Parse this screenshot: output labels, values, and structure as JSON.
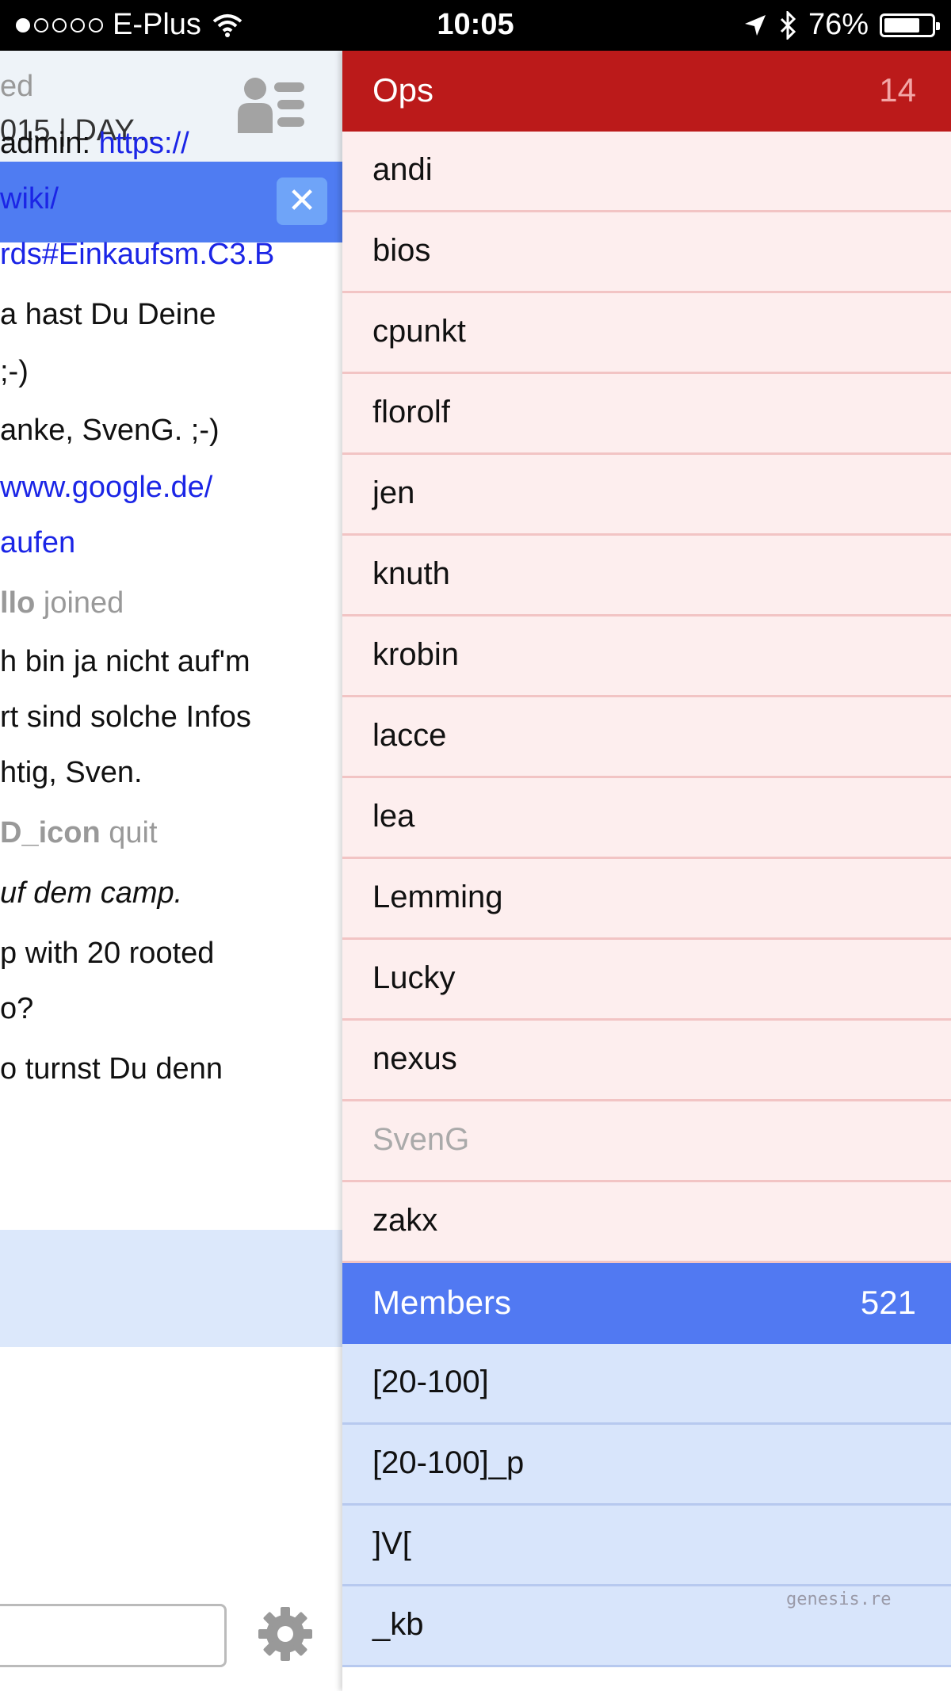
{
  "status_bar": {
    "signal_dots": [
      true,
      false,
      false,
      false,
      false
    ],
    "carrier": "E-Plus",
    "time": "10:05",
    "battery_percent": "76%",
    "battery_level": 0.76
  },
  "chat": {
    "title": "015 | DAY...",
    "close_label": "✕",
    "lines": [
      {
        "text": "ed",
        "style": "gray"
      },
      {
        "text": "admin: ",
        "link": "https://"
      },
      {
        "link": "wiki/"
      },
      {
        "link": "rds#Einkaufsm.C3.B"
      },
      {
        "text": "a hast Du Deine"
      },
      {
        "text": "    ;-)"
      },
      {
        "text": "anke, SvenG.   ;-)"
      },
      {
        "link": "www.google.de/"
      },
      {
        "link": "aufen"
      },
      {
        "nick": "llo",
        "text": " joined",
        "style": "gray"
      },
      {
        "text": "h bin ja nicht auf'm"
      },
      {
        "text": "rt sind solche Infos"
      },
      {
        "text": "htig, Sven."
      },
      {
        "nick": " D_icon",
        "text": " quit",
        "style": "gray"
      },
      {
        "text": "uf dem camp.",
        "style": "italic"
      },
      {
        "text": "p with 20 rooted"
      },
      {
        "text": "o?"
      },
      {
        "text": "o turnst Du denn"
      }
    ]
  },
  "ops": {
    "label": "Ops",
    "count": "14",
    "color": "#bb1a1a",
    "users": [
      "andi",
      "bios",
      "cpunkt",
      "florolf",
      "jen",
      "knuth",
      "krobin",
      "lacce",
      "lea",
      "Lemming",
      "Lucky",
      "nexus",
      "SvenG",
      "zakx"
    ],
    "away_users": [
      "SvenG"
    ]
  },
  "members": {
    "label": "Members",
    "count": "521",
    "color": "#5179f2",
    "users": [
      "[20-100]",
      "[20-100]_p",
      "]V[",
      "_kb"
    ]
  },
  "watermark": "genesis.re"
}
